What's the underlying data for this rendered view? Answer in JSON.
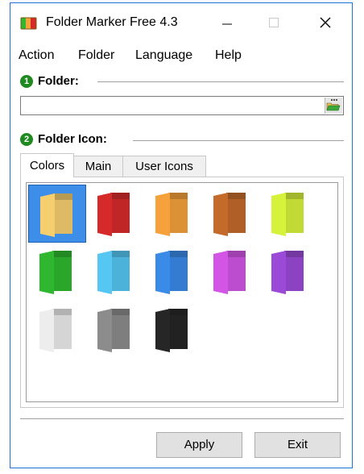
{
  "window": {
    "title": "Folder Marker Free 4.3",
    "icon": "folder-marker-app-icon"
  },
  "menu": [
    "Action",
    "Folder",
    "Language",
    "Help"
  ],
  "folder_section": {
    "number": "1",
    "label": "Folder:",
    "value": "",
    "browse_icon": "open-folder-icon"
  },
  "icon_section": {
    "number": "2",
    "label": "Folder Icon:"
  },
  "tabs": [
    "Colors",
    "Main",
    "User Icons"
  ],
  "active_tab": "Colors",
  "folder_colors": [
    {
      "name": "yellow",
      "color": "#f5cf6e",
      "selected": true
    },
    {
      "name": "red",
      "color": "#d62a2a"
    },
    {
      "name": "orange",
      "color": "#f5a13c"
    },
    {
      "name": "brown",
      "color": "#c46a2b"
    },
    {
      "name": "lime",
      "color": "#d6f23a"
    },
    {
      "name": "green",
      "color": "#2fb82f"
    },
    {
      "name": "light-blue",
      "color": "#56c6f2"
    },
    {
      "name": "blue",
      "color": "#3a8ae8"
    },
    {
      "name": "magenta",
      "color": "#d255e6"
    },
    {
      "name": "purple",
      "color": "#9a4ad6"
    },
    {
      "name": "white",
      "color": "#ededed"
    },
    {
      "name": "gray",
      "color": "#8c8c8c"
    },
    {
      "name": "black",
      "color": "#262626"
    }
  ],
  "buttons": {
    "apply": "Apply",
    "exit": "Exit"
  }
}
